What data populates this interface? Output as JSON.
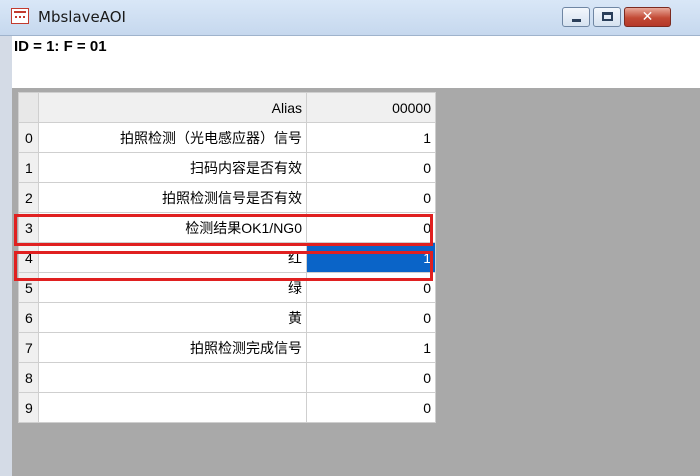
{
  "window": {
    "title": "MbslaveAOI"
  },
  "info": {
    "text": "ID = 1: F = 01"
  },
  "grid": {
    "headers": {
      "alias": "Alias",
      "value": "00000"
    },
    "rows": [
      {
        "num": "0",
        "alias": "拍照检测（光电感应器）信号",
        "value": "1"
      },
      {
        "num": "1",
        "alias": "扫码内容是否有效",
        "value": "0"
      },
      {
        "num": "2",
        "alias": "拍照检测信号是否有效",
        "value": "0"
      },
      {
        "num": "3",
        "alias": "检测结果OK1/NG0",
        "value": "0"
      },
      {
        "num": "4",
        "alias": "红",
        "value": "1"
      },
      {
        "num": "5",
        "alias": "绿",
        "value": "0"
      },
      {
        "num": "6",
        "alias": "黄",
        "value": "0"
      },
      {
        "num": "7",
        "alias": "拍照检测完成信号",
        "value": "1"
      },
      {
        "num": "8",
        "alias": "",
        "value": "0"
      },
      {
        "num": "9",
        "alias": "",
        "value": "0"
      }
    ]
  },
  "colors": {
    "selection": "#0a64c8",
    "highlight_border": "#e02020"
  }
}
